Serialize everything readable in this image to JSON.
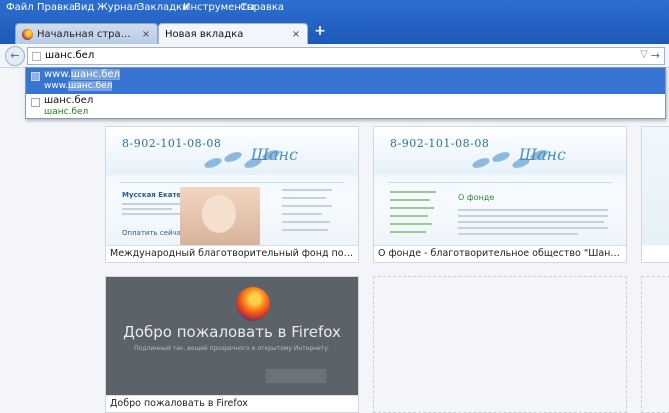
{
  "menu": [
    "Файл",
    "Правка",
    "Вид",
    "Журнал",
    "Закладки",
    "Инструменты",
    "Справка"
  ],
  "tabs": [
    {
      "label": "Начальная страница Mozilla ...",
      "close": "×"
    },
    {
      "label": "Новая вкладка",
      "close": "×"
    }
  ],
  "new_tab": "+",
  "navbar": {
    "back": "←",
    "url": "шанс.бел",
    "dropdown": "▽",
    "go": "→"
  },
  "autocomplete": [
    {
      "title_pre": "www.",
      "title_hl": "шанс.бел",
      "url_pre": "www.",
      "url_hl": "шанс.бел"
    },
    {
      "title": "шанс.бел",
      "url": "шанс.бел"
    }
  ],
  "tiles": [
    {
      "caption": "Международный благотворительный фонд помощи детям...",
      "phone": "8-902-101-08-08",
      "logo": "Шанс",
      "person": "Мусская Екатерина",
      "help": "Оплатить сейчас"
    },
    {
      "caption": "О фонде - благотворительное общество \"Шанс\" - - Между...",
      "phone": "8-902-101-08-08",
      "logo": "Шанс",
      "heading": "О фонде"
    },
    {
      "caption": "Добро пожаловать в Firefox",
      "title": "Добро пожаловать в Firefox",
      "subtitle": "Подлинный так, вещей прозрачного и открытому Интернету."
    }
  ],
  "colors": {
    "accent": "#3874d1",
    "window": "#1f5fbd"
  }
}
